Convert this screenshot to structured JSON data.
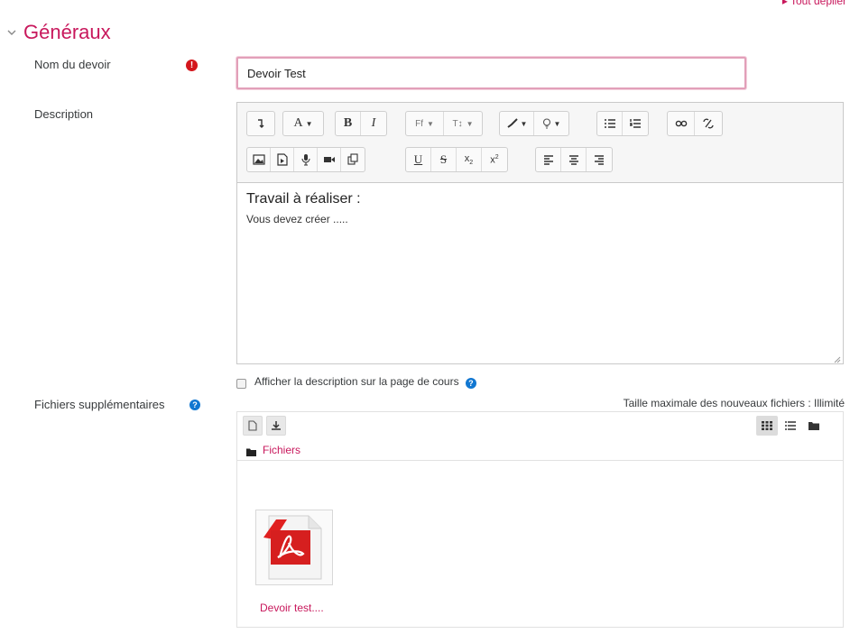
{
  "header": {
    "expand_all_label": "▸ Tout déplier",
    "section_title": "Généraux"
  },
  "name_field": {
    "label": "Nom du devoir",
    "value": "Devoir Test"
  },
  "description": {
    "label": "Description",
    "toolbar_row1": [
      "show-more-icon",
      "font-color-a-icon",
      "bold-icon",
      "italic-icon",
      "font-family-icon",
      "font-size-icon",
      "brush-icon",
      "lightbulb-icon",
      "unordered-list-icon",
      "ordered-list-icon",
      "link-icon",
      "unlink-icon"
    ],
    "toolbar_row2": [
      "image-icon",
      "media-icon",
      "microphone-icon",
      "video-icon",
      "manage-files-icon",
      "underline-icon",
      "strikethrough-icon",
      "subscript-icon",
      "superscript-icon",
      "align-left-icon",
      "align-center-icon",
      "align-right-icon"
    ],
    "content_heading": "Travail à réaliser :",
    "content_paragraph": "Vous devez créer ....."
  },
  "show_description": {
    "label": "Afficher la description sur la page de cours",
    "checked": false
  },
  "files": {
    "label": "Fichiers supplémentaires",
    "max_size_text": "Taille maximale des nouveaux fichiers : Illimité",
    "path_label": "Fichiers",
    "items": [
      {
        "name": "Devoir test....",
        "icon": "pdf-file-icon"
      }
    ]
  },
  "colors": {
    "accent": "#c8185c",
    "required": "#d4161c",
    "help": "#1177d1"
  }
}
